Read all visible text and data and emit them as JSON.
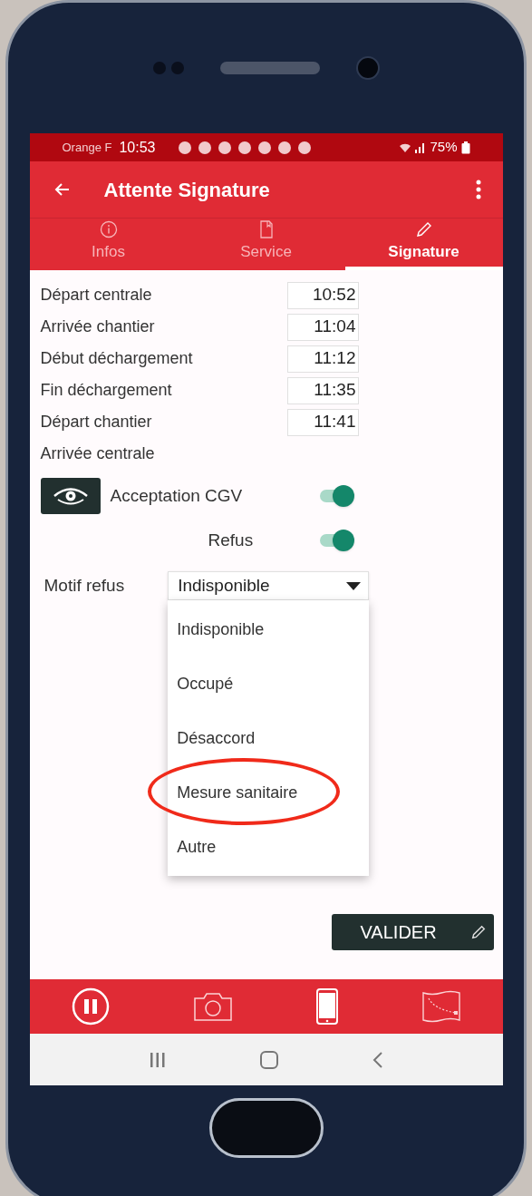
{
  "status_bar": {
    "carrier": "Orange F",
    "time": "10:53",
    "battery": "75%"
  },
  "app_bar": {
    "title": "Attente Signature"
  },
  "tabs": [
    {
      "label": "Infos",
      "kind": "info",
      "selected": false
    },
    {
      "label": "Service",
      "kind": "doc",
      "selected": false
    },
    {
      "label": "Signature",
      "kind": "pencil",
      "selected": true
    }
  ],
  "times": [
    {
      "label": "Départ centrale",
      "value": "10:52"
    },
    {
      "label": "Arrivée chantier",
      "value": "11:04"
    },
    {
      "label": "Début déchargement",
      "value": "11:12"
    },
    {
      "label": "Fin déchargement",
      "value": "11:35"
    },
    {
      "label": "Départ chantier",
      "value": "11:41"
    },
    {
      "label": "Arrivée centrale"
    }
  ],
  "toggles": [
    {
      "label": "Acceptation CGV",
      "kind": "with-eye",
      "on": true
    },
    {
      "label": "Refus",
      "kind": "plain",
      "on": true
    }
  ],
  "motif": {
    "label": "Motif refus",
    "value": "Indisponible",
    "expanded": true,
    "options": [
      {
        "label": "Indisponible",
        "circled": false
      },
      {
        "label": "Occupé",
        "circled": false
      },
      {
        "label": "Désaccord",
        "circled": false
      },
      {
        "label": "Mesure sanitaire",
        "circled": true
      },
      {
        "label": "Autre",
        "circled": false
      }
    ]
  },
  "valider_button": "VALIDER"
}
